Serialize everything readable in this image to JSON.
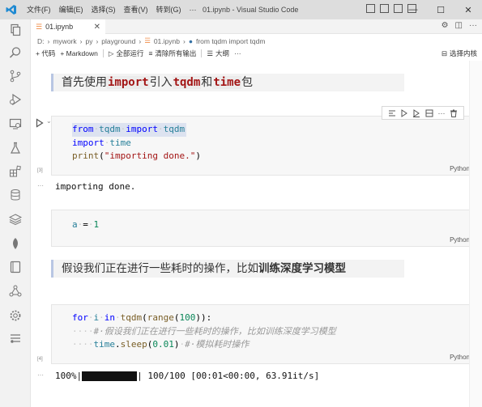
{
  "titlebar": {
    "menus": [
      "文件(F)",
      "编辑(E)",
      "选择(S)",
      "查看(V)",
      "转到(G)",
      "···"
    ],
    "window_title": "01.ipynb - Visual Studio Code"
  },
  "tab": {
    "label": "01.ipynb"
  },
  "breadcrumb": [
    "D:",
    "mywork",
    "py",
    "playground",
    "01.ipynb",
    "from tqdm import tqdm"
  ],
  "toolbar": {
    "code": "+ 代码",
    "markdown": "+ Markdown",
    "run_all": "全部运行",
    "clear_outputs": "清除所有输出",
    "outline": "大纲",
    "kernel": "选择内核"
  },
  "cells": {
    "md1": {
      "pre": "首先使用",
      "c1": "import",
      "mid1": "引入",
      "c2": "tqdm",
      "mid2": "和",
      "c3": "time",
      "post": "包"
    },
    "code1": {
      "l1_from": "from",
      "l1_mod": "tqdm",
      "l1_import": "import",
      "l1_name": "tqdm",
      "l2_import": "import",
      "l2_mod": "time",
      "l3_fn": "print",
      "l3_str": "\"importing done.\"",
      "exec": "[3]",
      "lang": "Python",
      "output": "importing done."
    },
    "code2": {
      "var": "a",
      "op": "=",
      "num": "1",
      "lang": "Python"
    },
    "md2": {
      "pre": "假设我们正在进行一些耗时的操作，比如",
      "bold": "训练深度学习模型"
    },
    "code3": {
      "l1_for": "for",
      "l1_i": "i",
      "l1_in": "in",
      "l1_fn": "tqdm",
      "l1_range": "range",
      "l1_num": "100",
      "l2_dots": "····",
      "l2_cmt": "#·假设我们正在进行一些耗时的操作，比如训练深度学习模型",
      "l3_dots": "····",
      "l3_mod": "time",
      "l3_fn": "sleep",
      "l3_num": "0.01",
      "l3_cmt": "#·模拟耗时操作",
      "exec": "[4]",
      "lang": "Python",
      "out_pct": "100%|",
      "out_rest": "| 100/100 [00:01<00:00, 63.91it/s]"
    }
  },
  "colors": {
    "accent": "#007acc",
    "progress": "#111111"
  }
}
